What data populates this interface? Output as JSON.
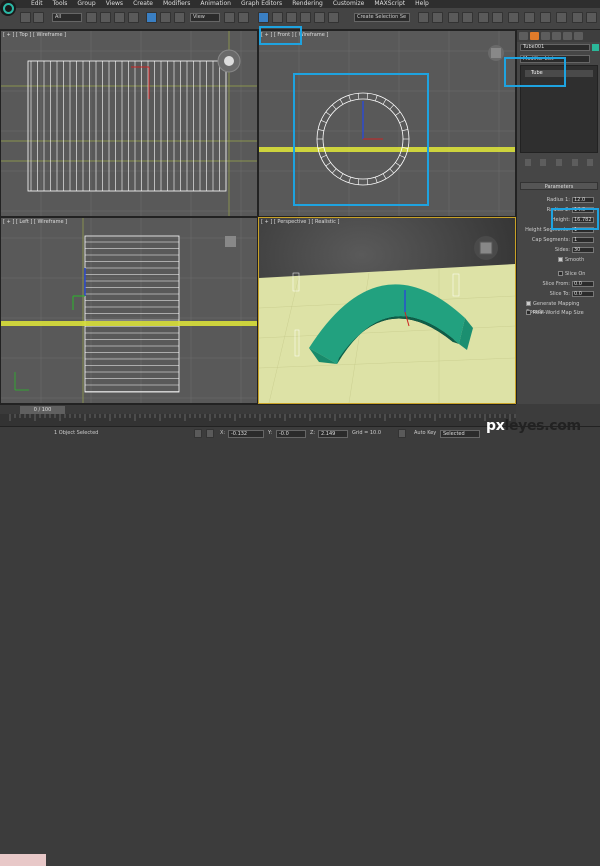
{
  "menu": [
    "Edit",
    "Tools",
    "Group",
    "Views",
    "Create",
    "Modifiers",
    "Animation",
    "Graph Editors",
    "Rendering",
    "Customize",
    "MAXScript",
    "Help"
  ],
  "toolbar": {
    "filter_value": "All",
    "view_value": "View",
    "selection_set": "Create Selection Se"
  },
  "viewports": {
    "top": "[ + ] [ Top ] [ Wireframe ]",
    "front": "[ + ] [ Front ] [ Wireframe ]",
    "left": "[ + ] [ Left ] [ Wireframe ]",
    "perspective": "[ + ] [ Perspective ] [ Realistic ]"
  },
  "command_panel": {
    "object_name": "Tube001",
    "modifier_list": "Modifier List",
    "stack_item": "Tube",
    "rollout_title": "Parameters",
    "params": [
      {
        "label": "Radius 1:",
        "value": "12.0"
      },
      {
        "label": "Radius 2:",
        "value": "14.0"
      },
      {
        "label": "Height:",
        "value": "16.782"
      },
      {
        "label": "Height Segments:",
        "value": "1"
      },
      {
        "label": "Cap Segments:",
        "value": "1"
      },
      {
        "label": "Sides:",
        "value": "30"
      }
    ],
    "smooth": "Smooth",
    "slice_on": "Slice On",
    "slice_from": "Slice From:",
    "slice_to": "Slice To:",
    "slice_from_value": "0.0",
    "slice_to_value": "0.0",
    "gen_mapping": "Generate Mapping Coords.",
    "real_world": "Real-World Map Size"
  },
  "timeline": {
    "slider": "0 / 100"
  },
  "status": {
    "selected": "1 Object Selected",
    "x_label": "X:",
    "x_value": "-0.132",
    "y_label": "Y:",
    "y_value": "-0.0",
    "z_label": "Z:",
    "z_value": "2.149",
    "grid": "Grid = 10.0",
    "autokey": "Auto Key",
    "selected_dropdown": "Selected"
  },
  "watermark": {
    "part1": "px",
    "part2": "leyes.com"
  }
}
